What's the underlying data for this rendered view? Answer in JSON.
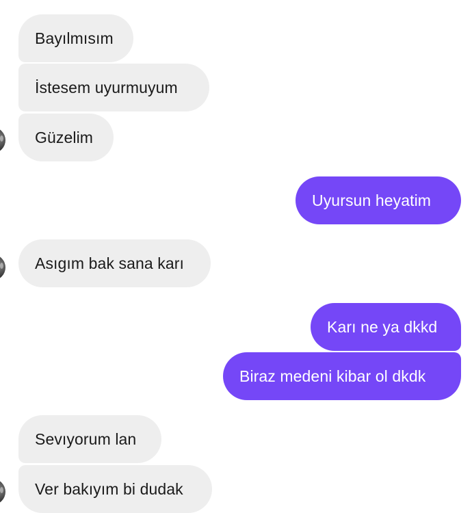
{
  "conversation": {
    "messages": [
      {
        "direction": "incoming",
        "text": "Bayılmısım"
      },
      {
        "direction": "incoming",
        "text": "İstesem uyurmuyum"
      },
      {
        "direction": "incoming",
        "text": "Güzelim"
      },
      {
        "direction": "outgoing",
        "text": "Uyursun heyatim"
      },
      {
        "direction": "incoming",
        "text": "Asıgım bak sana karı"
      },
      {
        "direction": "outgoing",
        "text": "Karı ne ya dkkd"
      },
      {
        "direction": "outgoing",
        "text": "Biraz medeni kibar ol dkdk"
      },
      {
        "direction": "incoming",
        "text": "Sevıyorum lan"
      },
      {
        "direction": "incoming",
        "text": "Ver bakıyım bi dudak"
      }
    ],
    "avatar_icon": "contact-avatar",
    "colors": {
      "incoming_bubble": "#eeeeee",
      "outgoing_bubble": "#7547f7",
      "incoming_text": "#1a1a1a",
      "outgoing_text": "#ffffff"
    }
  }
}
